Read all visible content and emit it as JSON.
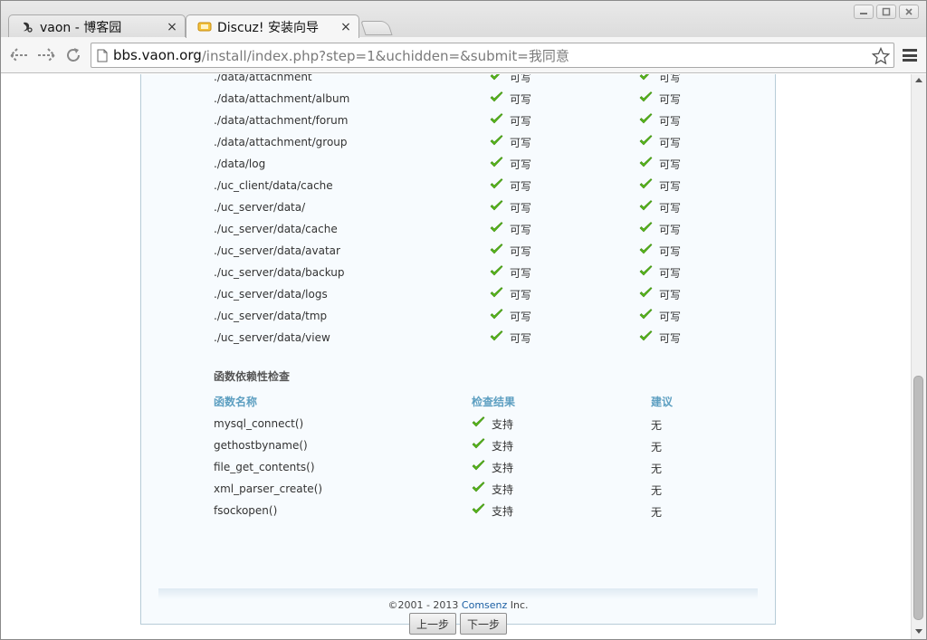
{
  "browser": {
    "tabs": [
      {
        "title": "vaon - 博客园",
        "active": false,
        "icon": "vaon-favicon"
      },
      {
        "title": "Discuz! 安装向导",
        "active": true,
        "icon": "discuz-favicon"
      }
    ],
    "url": {
      "host": "bbs.vaon.org",
      "path": "/install/index.php?step=1&uchidden=&submit=我同意"
    }
  },
  "directory_checks": [
    {
      "path": "./data/attachment",
      "current": "可写",
      "required": "可写"
    },
    {
      "path": "./data/attachment/album",
      "current": "可写",
      "required": "可写"
    },
    {
      "path": "./data/attachment/forum",
      "current": "可写",
      "required": "可写"
    },
    {
      "path": "./data/attachment/group",
      "current": "可写",
      "required": "可写"
    },
    {
      "path": "./data/log",
      "current": "可写",
      "required": "可写"
    },
    {
      "path": "./uc_client/data/cache",
      "current": "可写",
      "required": "可写"
    },
    {
      "path": "./uc_server/data/",
      "current": "可写",
      "required": "可写"
    },
    {
      "path": "./uc_server/data/cache",
      "current": "可写",
      "required": "可写"
    },
    {
      "path": "./uc_server/data/avatar",
      "current": "可写",
      "required": "可写"
    },
    {
      "path": "./uc_server/data/backup",
      "current": "可写",
      "required": "可写"
    },
    {
      "path": "./uc_server/data/logs",
      "current": "可写",
      "required": "可写"
    },
    {
      "path": "./uc_server/data/tmp",
      "current": "可写",
      "required": "可写"
    },
    {
      "path": "./uc_server/data/view",
      "current": "可写",
      "required": "可写"
    }
  ],
  "function_check": {
    "title": "函数依赖性检查",
    "headers": {
      "name": "函数名称",
      "result": "检查结果",
      "advice": "建议"
    },
    "rows": [
      {
        "name": "mysql_connect()",
        "result": "支持",
        "advice": "无"
      },
      {
        "name": "gethostbyname()",
        "result": "支持",
        "advice": "无"
      },
      {
        "name": "file_get_contents()",
        "result": "支持",
        "advice": "无"
      },
      {
        "name": "xml_parser_create()",
        "result": "支持",
        "advice": "无"
      },
      {
        "name": "fsockopen()",
        "result": "支持",
        "advice": "无"
      }
    ]
  },
  "buttons": {
    "prev": "上一步",
    "next": "下一步"
  },
  "footer": {
    "copyright": "©2001 - 2013 ",
    "brand": "Comsenz",
    "suffix": " Inc."
  },
  "colors": {
    "check": "#57b81a",
    "header": "#5d9fc1",
    "brand": "#1b5fa3"
  }
}
